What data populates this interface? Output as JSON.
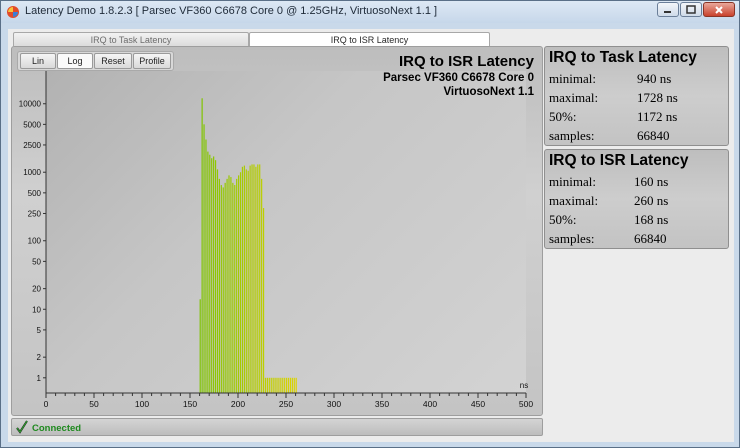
{
  "window": {
    "title": "Latency Demo 1.8.2.3  [ Parsec VF360 C6678 Core 0 @ 1.25GHz, VirtuosoNext 1.1 ]",
    "app_icon": "latency-app-icon",
    "controls": [
      "minimize-icon",
      "maximize-icon",
      "close-icon"
    ]
  },
  "tabs": [
    {
      "label": "IRQ to Task Latency",
      "active": false
    },
    {
      "label": "IRQ to ISR Latency",
      "active": true
    }
  ],
  "toolbar": {
    "lin": "Lin",
    "log": "Log",
    "reset": "Reset",
    "profile": "Profile",
    "selected": "Log"
  },
  "plot": {
    "title": "IRQ to ISR Latency",
    "subtitle1": "Parsec VF360 C6678 Core 0",
    "subtitle2": "VirtuosoNext 1.1"
  },
  "chart_data": {
    "type": "bar",
    "yscale": "log",
    "x_unit": "ns",
    "xlim": [
      0,
      500
    ],
    "x_ticks": [
      "0",
      "50",
      "100",
      "150",
      "200",
      "250",
      "300",
      "350",
      "400",
      "450",
      "500"
    ],
    "y_ticks": [
      "1",
      "2",
      "5",
      "10",
      "20",
      "50",
      "100",
      "250",
      "500",
      "1000",
      "2500",
      "5000",
      "10000"
    ],
    "x": [
      160,
      162,
      164,
      166,
      168,
      170,
      172,
      174,
      176,
      178,
      180,
      182,
      184,
      186,
      188,
      190,
      192,
      194,
      196,
      198,
      200,
      202,
      204,
      206,
      208,
      210,
      212,
      214,
      216,
      218,
      220,
      222,
      224,
      226,
      228,
      230,
      232,
      234,
      236,
      238,
      240,
      242,
      244,
      246,
      248,
      250,
      252,
      254,
      256,
      258,
      260
    ],
    "values": [
      14,
      12000,
      5000,
      3000,
      2000,
      1800,
      1600,
      1700,
      1500,
      1100,
      800,
      650,
      600,
      700,
      800,
      900,
      850,
      700,
      650,
      800,
      900,
      1000,
      1200,
      1250,
      1100,
      1050,
      1250,
      1300,
      1300,
      1200,
      1300,
      1300,
      800,
      300,
      1,
      1,
      1,
      1,
      1,
      1,
      1,
      1,
      1,
      1,
      1,
      1,
      1,
      1,
      1,
      1,
      1
    ],
    "bar_gradient": [
      "#7ec400",
      "#dcd400"
    ],
    "grid": false
  },
  "stats_task": {
    "title": "IRQ to Task Latency",
    "rows": [
      {
        "label": "minimal:",
        "value": "940 ns"
      },
      {
        "label": "maximal:",
        "value": "1728 ns"
      },
      {
        "label": "50%:",
        "value": "1172 ns"
      },
      {
        "label": "samples:",
        "value": "66840"
      }
    ]
  },
  "stats_isr": {
    "title": "IRQ to ISR Latency",
    "rows": [
      {
        "label": "minimal:",
        "value": "160 ns"
      },
      {
        "label": "maximal:",
        "value": "260 ns"
      },
      {
        "label": "50%:",
        "value": "168 ns"
      },
      {
        "label": "samples:",
        "value": "66840"
      }
    ]
  },
  "status": {
    "text": "Connected",
    "icon": "checkmark-icon",
    "color": "#1f8a1f"
  }
}
